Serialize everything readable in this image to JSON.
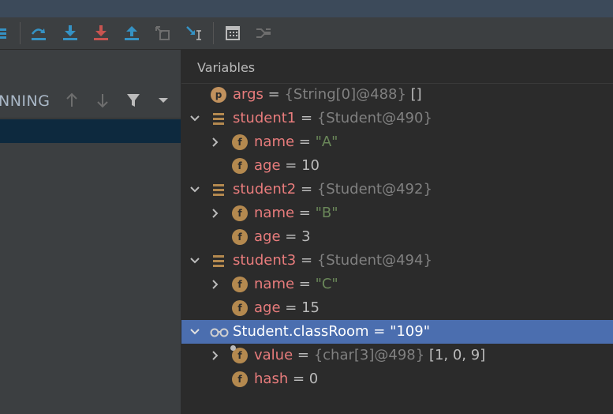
{
  "colors": {
    "toolbar_bg": "#3c3f41",
    "panel_bg": "#2b2b2b",
    "selected_row": "#4b6eaf",
    "thread_selected": "#0d293e",
    "name_color": "#e87c7c",
    "string_color": "#6a8759",
    "ref_color": "#808080",
    "field_badge": "#b4894f"
  },
  "toolbar": {
    "icons": [
      "show-execution-point-icon",
      "step-over-icon",
      "step-into-icon",
      "force-step-into-icon",
      "step-out-icon",
      "drop-frame-icon",
      "run-to-cursor-icon",
      "evaluate-expression-icon",
      "trace-current-stream-icon"
    ]
  },
  "frames_panel": {
    "status": "NNING"
  },
  "variables": {
    "title": "Variables",
    "rows": [
      {
        "name": "args",
        "eq": " = ",
        "ref": "{String[0]@488}",
        "value": " []"
      },
      {
        "name": "student1",
        "eq": " = ",
        "ref": "{Student@490}",
        "value": ""
      },
      {
        "name": "name",
        "eq": " = ",
        "ref": "",
        "value": "\"A\""
      },
      {
        "name": "age",
        "eq": " = ",
        "ref": "",
        "value": "10"
      },
      {
        "name": "student2",
        "eq": " = ",
        "ref": "{Student@492}",
        "value": ""
      },
      {
        "name": "name",
        "eq": " = ",
        "ref": "",
        "value": "\"B\""
      },
      {
        "name": "age",
        "eq": " = ",
        "ref": "",
        "value": "3"
      },
      {
        "name": "student3",
        "eq": " = ",
        "ref": "{Student@494}",
        "value": ""
      },
      {
        "name": "name",
        "eq": " = ",
        "ref": "",
        "value": "\"C\""
      },
      {
        "name": "age",
        "eq": " = ",
        "ref": "",
        "value": "15"
      },
      {
        "name": "Student.classRoom",
        "eq": " = ",
        "ref": "",
        "value": "\"109\""
      },
      {
        "name": "value",
        "eq": " = ",
        "ref": "{char[3]@498}",
        "value": " [1, 0, 9]"
      },
      {
        "name": "hash",
        "eq": " = ",
        "ref": "",
        "value": "0"
      }
    ],
    "badges": {
      "p": "p",
      "f": "f"
    }
  }
}
